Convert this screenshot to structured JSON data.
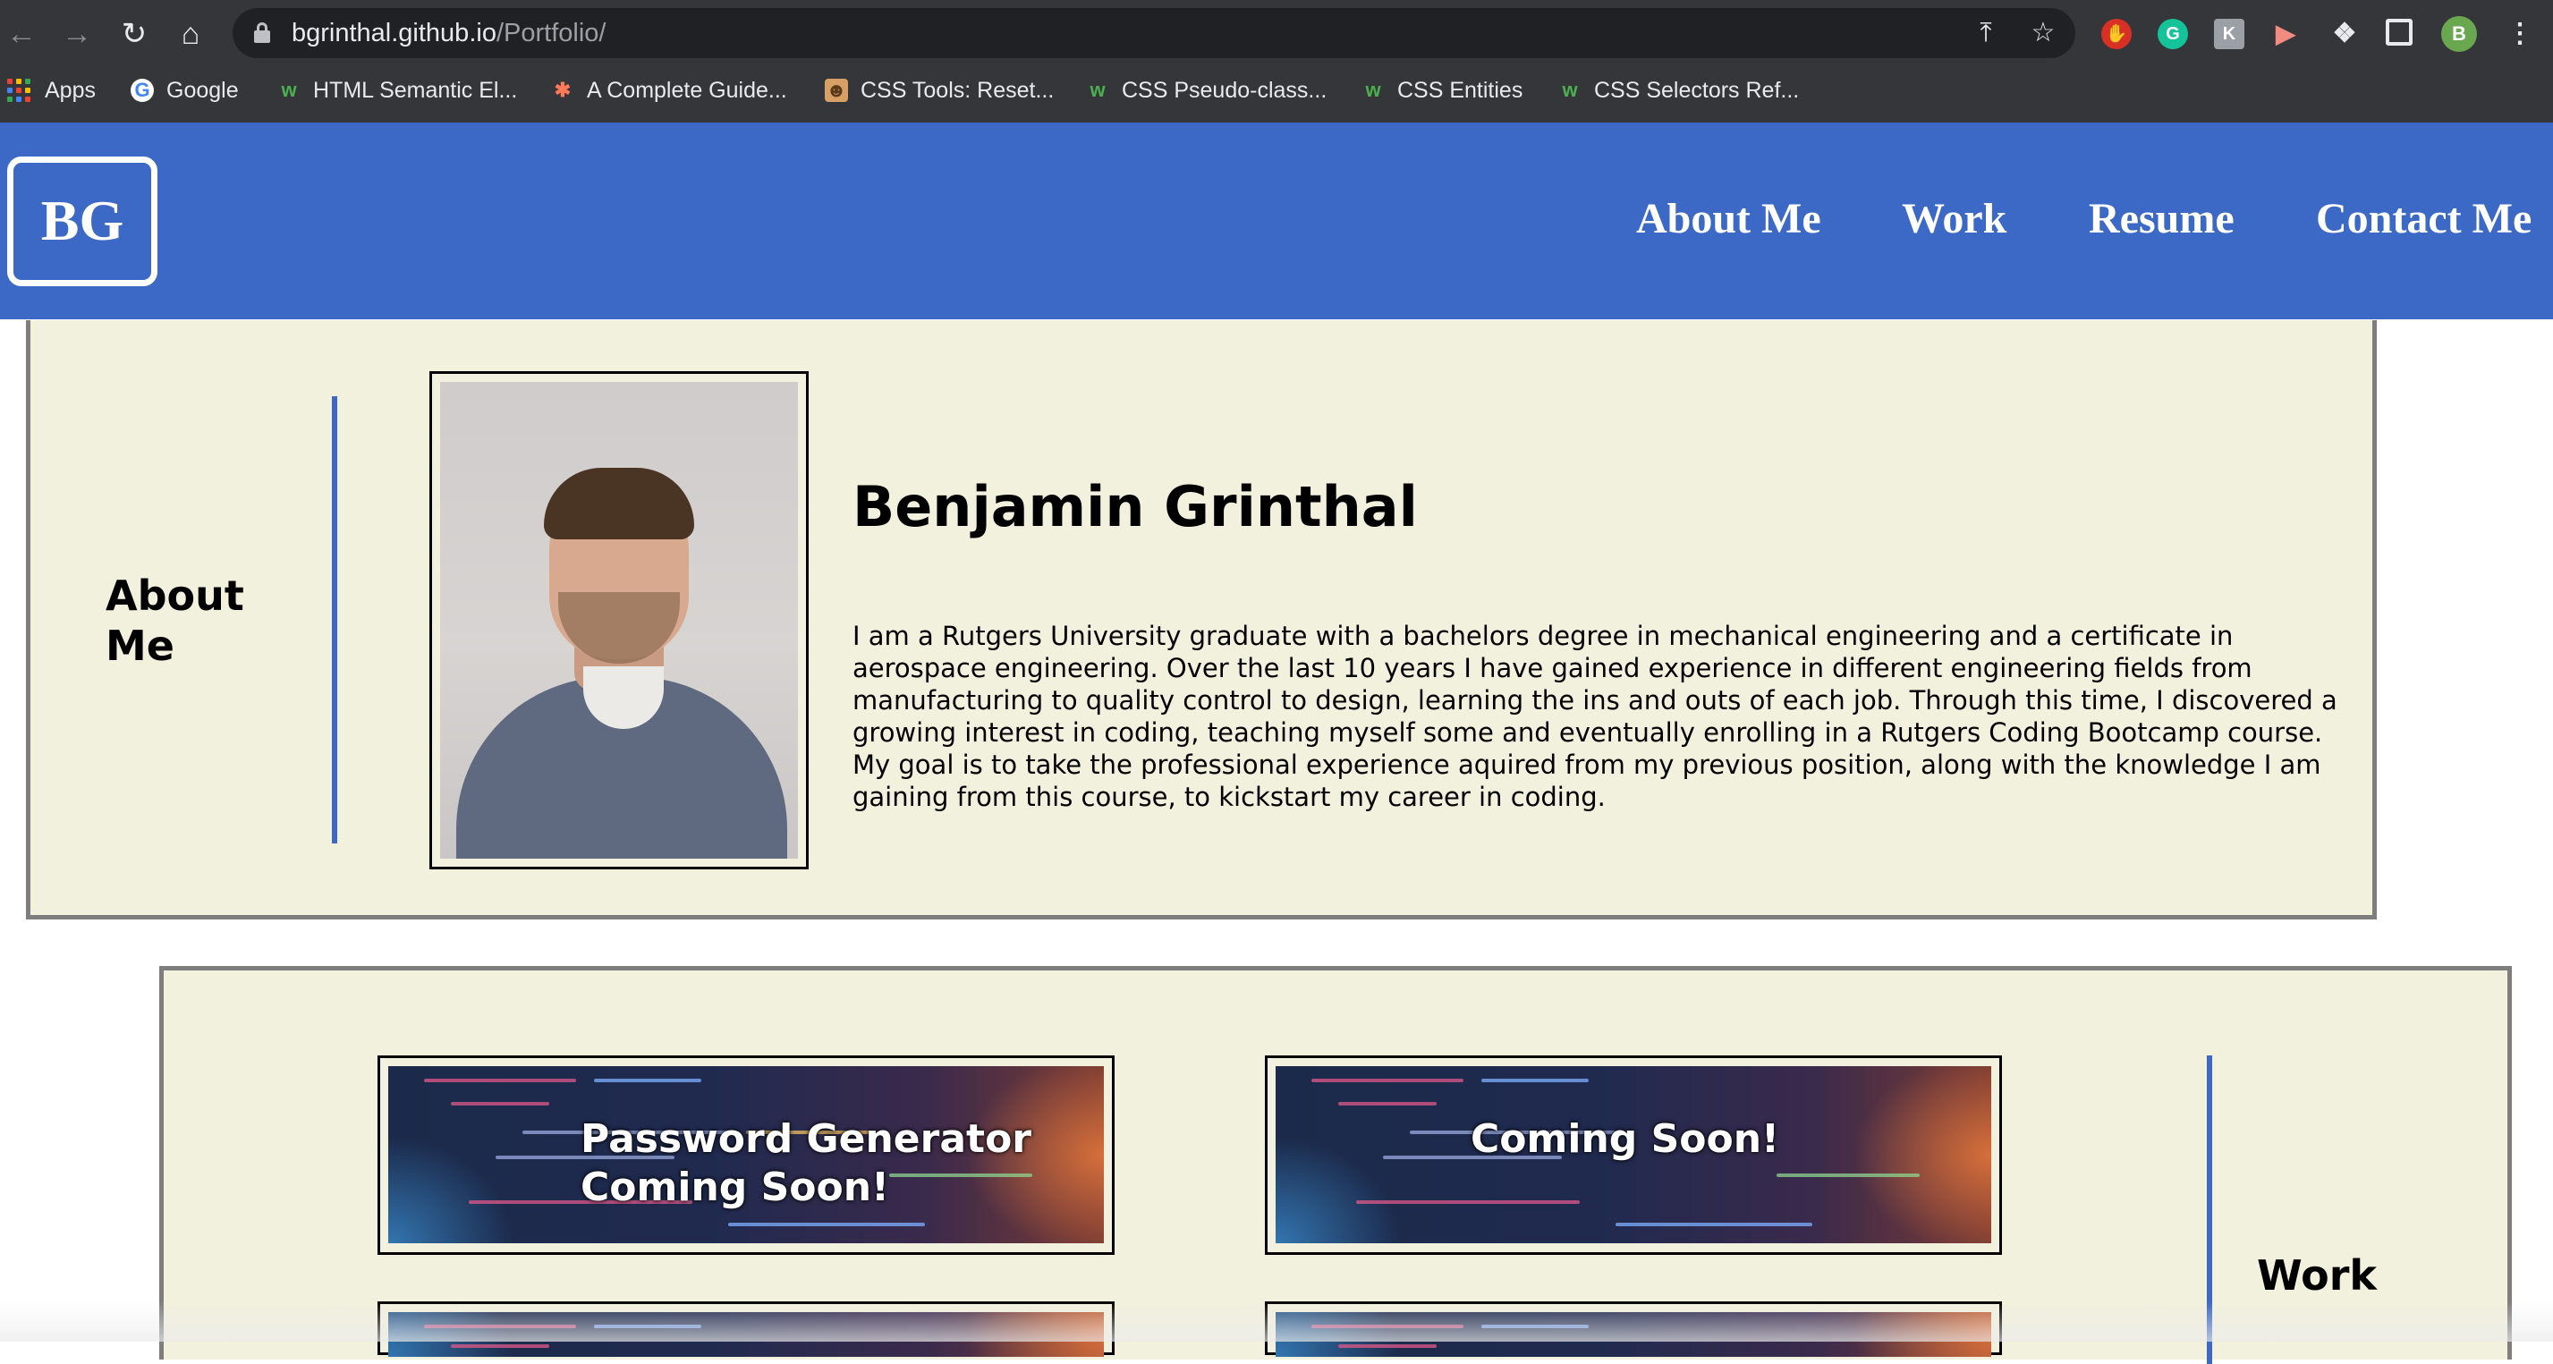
{
  "browser": {
    "url_host": "bgrinthal.github.io",
    "url_path": "/Portfolio/",
    "profile_initial": "B",
    "bookmarks": [
      {
        "label": "Apps"
      },
      {
        "label": "Google"
      },
      {
        "label": "HTML Semantic El..."
      },
      {
        "label": "A Complete Guide..."
      },
      {
        "label": "CSS Tools: Reset..."
      },
      {
        "label": "CSS Pseudo-class..."
      },
      {
        "label": "CSS Entities"
      },
      {
        "label": "CSS Selectors Ref..."
      }
    ]
  },
  "site": {
    "logo": "BG",
    "nav": [
      "About Me",
      "Work",
      "Resume",
      "Contact Me"
    ]
  },
  "about": {
    "title_line1": "About",
    "title_line2": "Me",
    "name": "Benjamin Grinthal",
    "bio": "I am a Rutgers University graduate with a bachelors degree in mechanical engineering and a certificate in aerospace engineering. Over the last 10 years I have gained experience in different engineering fields from manufacturing to quality control to design, learning the ins and outs of each job. Through this time, I discovered a growing interest in coding, teaching myself some and eventually enrolling in a Rutgers Coding Bootcamp course. My goal is to take the professional experience aquired from my previous position, along with the knowledge I am gaining from this course, to kickstart my career in coding."
  },
  "work": {
    "title": "Work",
    "projects": [
      {
        "line1": "Password Generator",
        "line2": "Coming Soon!"
      },
      {
        "line1": "Coming Soon!"
      }
    ]
  }
}
